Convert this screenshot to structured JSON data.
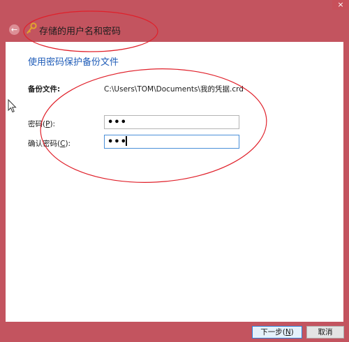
{
  "window": {
    "title": "存储的用户名和密码",
    "close_glyph": "×",
    "back_glyph": "←",
    "key_icon": "key-icon"
  },
  "main": {
    "heading": "使用密码保护备份文件",
    "backup_file": {
      "label": "备份文件:",
      "path": "C:\\Users\\TOM\\Documents\\我的凭据.crd"
    },
    "password": {
      "label_text": "密码(",
      "label_accesskey": "P",
      "label_suffix": "):",
      "masked_value": "•••"
    },
    "confirm_password": {
      "label_text": "确认密码(",
      "label_accesskey": "C",
      "label_suffix": "):",
      "masked_value": "•••"
    }
  },
  "footer": {
    "next_text": "下一步(",
    "next_accesskey": "N",
    "next_suffix": ")",
    "cancel_label": "取消"
  },
  "colors": {
    "chrome": "#c3545f",
    "heading_blue": "#1f5cb8",
    "annotation_red": "#e0202a",
    "focus_border": "#4a8fd8"
  }
}
